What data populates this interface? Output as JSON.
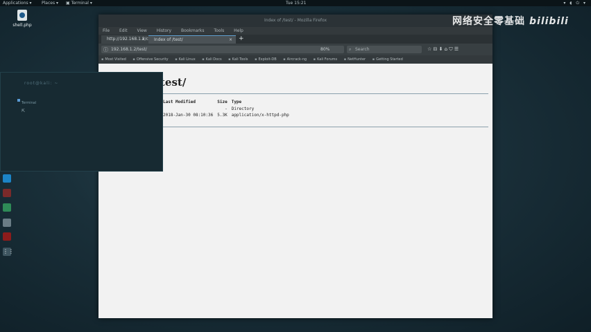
{
  "top_panel": {
    "menus": [
      {
        "label": "Applications ▾"
      },
      {
        "label": "Places ▾"
      },
      {
        "label": "▣ Terminal ▾"
      }
    ],
    "clock": "Tue 15:21",
    "tray": "▾ ◖ ⏻ ▾"
  },
  "desktop": {
    "icons": [
      {
        "label": "shell.php",
        "icon": "php-file-icon"
      }
    ]
  },
  "dock": {
    "items": [
      {
        "name": "firefox-icon",
        "color": "#e66000"
      },
      {
        "name": "terminal-icon",
        "color": "#2b2b2b"
      },
      {
        "name": "files-icon",
        "color": "#3a7bd5"
      },
      {
        "name": "metasploit-icon",
        "color": "#3b5998"
      },
      {
        "name": "armitage-icon",
        "color": "#5b6b73"
      },
      {
        "name": "burpsuite-icon",
        "color": "#e8772e"
      },
      {
        "name": "maltego-icon",
        "color": "#1c84c6"
      },
      {
        "name": "beef-icon",
        "color": "#7a2a2a"
      },
      {
        "name": "faraday-icon",
        "color": "#2e8b57"
      },
      {
        "name": "leafpad-icon",
        "color": "#6a7d86"
      },
      {
        "name": "cherrytree-icon",
        "color": "#8c1c1c"
      },
      {
        "name": "show-apps-icon",
        "color": "#3e5560"
      }
    ]
  },
  "firefox": {
    "title": "Index of /test/ - Mozilla Firefox",
    "menu": [
      "File",
      "Edit",
      "View",
      "History",
      "Bookmarks",
      "Tools",
      "Help"
    ],
    "tabs": [
      {
        "label": "http://192.168.1.2/cgi/"
      },
      {
        "label": "Index of /test/"
      }
    ],
    "url": "192.168.1.2/test/",
    "zoom": "80%",
    "search_placeholder": "Search",
    "nav_icons": "☆ ⊟ ⬇ ⌂ ⛉ ☰",
    "bookmarks": [
      "Most Visited",
      "Offensive Security",
      "Kali Linux",
      "Kali Docs",
      "Kali Tools",
      "Exploit-DB",
      "Aircrack-ng",
      "Kali Forums",
      "NetHunter",
      "Getting Started"
    ]
  },
  "page": {
    "heading": "test/",
    "columns": [
      "Last Modified",
      "Size",
      "Type"
    ],
    "rows": [
      {
        "modified": "",
        "size": "-",
        "type": "Directory"
      },
      {
        "modified": "2018-Jan-30 08:10:36",
        "size": "5.3K",
        "type": "application/x-httpd-php"
      }
    ]
  },
  "terminal": {
    "title": "root@kali: ~",
    "tab_label": "Terminal"
  },
  "watermark": {
    "text": "网络安全零基础",
    "brand": "bilibili"
  }
}
